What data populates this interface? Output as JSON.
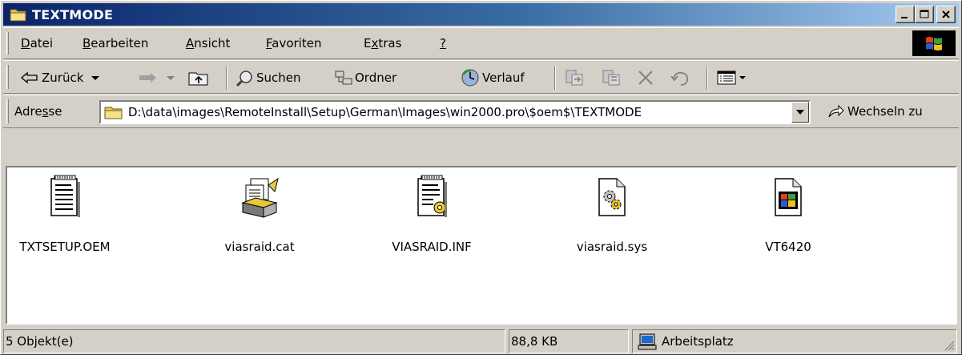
{
  "window": {
    "title": "TEXTMODE",
    "buttons": {
      "minimize": "minimize",
      "maximize": "maximize",
      "close": "close"
    }
  },
  "menu": {
    "items": [
      {
        "pre": "",
        "u": "D",
        "post": "atei"
      },
      {
        "pre": "",
        "u": "B",
        "post": "earbeiten"
      },
      {
        "pre": "",
        "u": "A",
        "post": "nsicht"
      },
      {
        "pre": "",
        "u": "F",
        "post": "avoriten"
      },
      {
        "pre": "E",
        "u": "x",
        "post": "tras"
      },
      {
        "pre": "",
        "u": "?",
        "post": ""
      }
    ]
  },
  "toolbar": {
    "back_label": "Zurück",
    "search_label": "Suchen",
    "folders_label": "Ordner",
    "history_label": "Verlauf"
  },
  "address": {
    "label_pre": "Adre",
    "label_u": "s",
    "label_post": "se",
    "path": "D:\\data\\images\\RemoteInstall\\Setup\\German\\Images\\win2000.pro\\$oem$\\TEXTMODE",
    "go_label": "Wechseln zu"
  },
  "files": [
    {
      "name": "TXTSETUP.OEM",
      "icon": "text-file-icon"
    },
    {
      "name": "viasraid.cat",
      "icon": "catalog-file-icon"
    },
    {
      "name": "VIASRAID.INF",
      "icon": "setup-info-file-icon"
    },
    {
      "name": "viasraid.sys",
      "icon": "system-file-icon"
    },
    {
      "name": "VT6420",
      "icon": "windows-file-icon"
    }
  ],
  "status": {
    "count": "5 Objekt(e)",
    "size": "88,8 KB",
    "location": "Arbeitsplatz"
  },
  "colors": {
    "title_start": "#0a246a",
    "title_end": "#a6caf0",
    "face": "#d4d0c8"
  }
}
